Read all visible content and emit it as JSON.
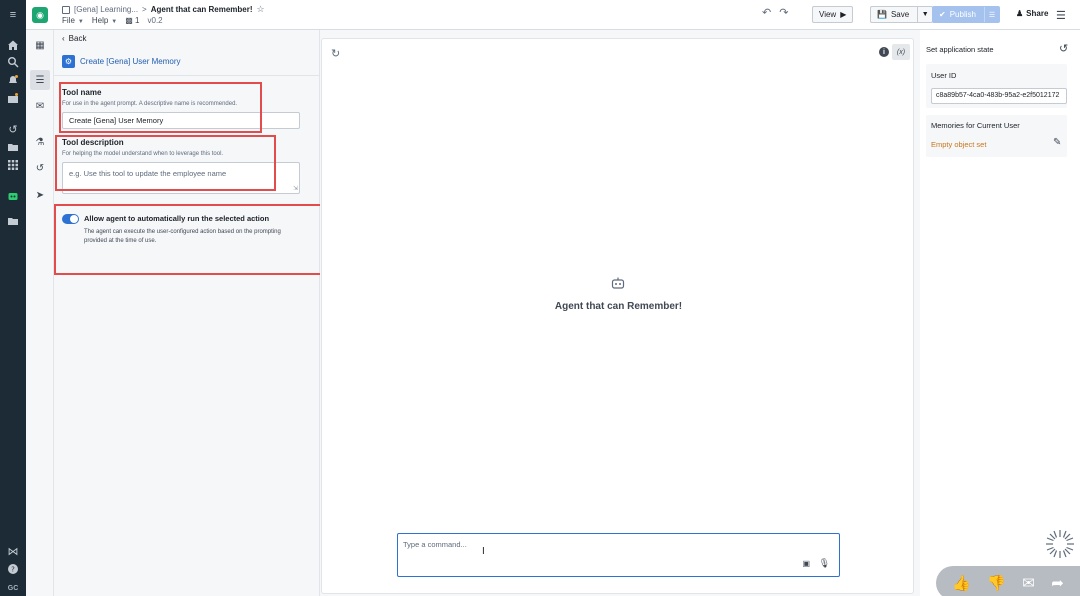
{
  "app": {
    "breadcrumb_parent": "[Gena] Learning...",
    "breadcrumb_sep": ">",
    "title": "Agent that can Remember!",
    "menu_file": "File",
    "menu_help": "Help",
    "branch_count": "1",
    "version": "v0.2"
  },
  "toolbar": {
    "view_label": "View",
    "save_label": "Save",
    "publish_label": "Publish",
    "share_label": "Share"
  },
  "user": {
    "initials": "GC"
  },
  "config": {
    "back_label": "Back",
    "tool_title": "Create [Gena] User Memory",
    "tool_name_label": "Tool name",
    "tool_name_help": "For use in the agent prompt. A descriptive name is recommended.",
    "tool_name_value": "Create [Gena] User Memory",
    "tool_desc_label": "Tool description",
    "tool_desc_help": "For helping the model understand when to leverage this tool.",
    "tool_desc_placeholder": "e.g. Use this tool to update the employee name",
    "auto_run_label": "Allow agent to automatically run the selected action",
    "auto_run_help": "The agent can execute the user-configured action based on the prompting provided at the time of use.",
    "auto_run_enabled": true
  },
  "main": {
    "agent_title": "Agent that can Remember!",
    "var_button": "(x)",
    "command_placeholder": "Type a command..."
  },
  "state_panel": {
    "title": "Set application state",
    "user_id_label": "User ID",
    "user_id_value": "c8a89b57-4ca0-483b-95a2-e2f5012172",
    "memories_label": "Memories for Current User",
    "memories_value": "Empty object set"
  },
  "colors": {
    "accent": "#2d72d2",
    "brand_green": "#1ea672",
    "highlight_red": "#e34c4c",
    "link_orange": "#c87619",
    "rail_bg": "#1c2b36"
  },
  "icons": {
    "rail": [
      "expand-icon",
      "home-icon",
      "search-icon",
      "notifications-icon",
      "apps-icon",
      "history-icon",
      "folder-icon",
      "grid-icon",
      "agent-icon",
      "projects-icon",
      "help-icon",
      "user-avatar"
    ],
    "secondary": [
      "table-icon",
      "sliders-icon",
      "chat-icon",
      "flask-icon",
      "history-icon",
      "rocket-icon"
    ]
  }
}
